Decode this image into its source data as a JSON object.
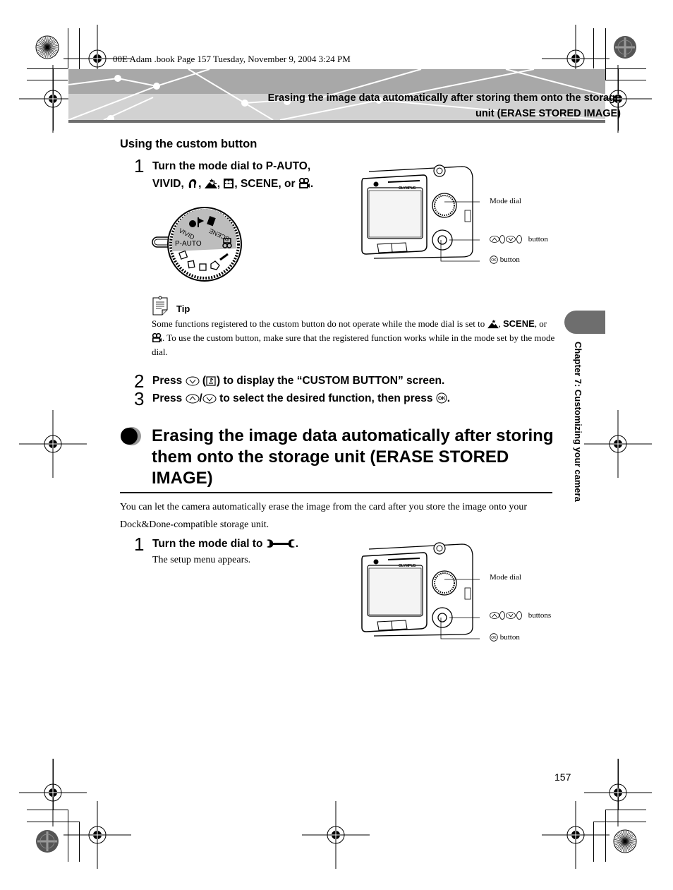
{
  "print_info": "00E Adam .book  Page 157  Tuesday, November 9, 2004  3:24 PM",
  "header": {
    "title_line1": "Erasing the image data automatically after storing them onto the storage",
    "title_line2": "unit (ERASE STORED IMAGE)"
  },
  "custom_button": {
    "subheading": "Using the custom button",
    "step1": {
      "number": "1",
      "line1": "Turn the mode dial to P-AUTO,",
      "line2_prefix": "VIVID,",
      "sep1": ",",
      "sep2": ",",
      "line2_scene": ", SCENE, or",
      "line2_end": "."
    },
    "dial": {
      "labels": [
        "VIVID",
        "P-AUTO",
        "SCENE"
      ]
    },
    "camera1_callouts": {
      "mode_dial": "Mode dial",
      "arrow_buttons": "button",
      "ok_button": "button"
    },
    "tip": {
      "title": "Tip",
      "text_part1": "Some functions registered to the custom button do not operate while the mode dial is set to",
      "text_part2": ",",
      "scene": "SCENE",
      "text_part3": ", or",
      "text_part4": ". To use the custom button, make sure that the registered function works while in the mode set by the mode dial."
    },
    "step2": {
      "number": "2",
      "prefix": "Press",
      "suffix": ") to display the “CUSTOM BUTTON” screen.",
      "open_paren": "("
    },
    "step3": {
      "number": "3",
      "prefix": "Press",
      "slash": "/",
      "middle": "to select the desired function, then press",
      "end": "."
    }
  },
  "erase_section": {
    "title": "Erasing the image data automatically after storing them onto the storage unit (ERASE STORED IMAGE)",
    "intro": "You can let the camera automatically erase the image from the card after you store the image onto your Dock&Done-compatible storage unit.",
    "step1": {
      "number": "1",
      "text": "Turn the mode dial to",
      "end": ".",
      "note": "The setup menu appears."
    },
    "camera2_callouts": {
      "mode_dial": "Mode dial",
      "arrow_buttons": "buttons",
      "ok_button": "button"
    }
  },
  "side_tab": {
    "chapter_label": "Chapter 7: Customizing your camera"
  },
  "footer": {
    "page_number": "157"
  },
  "icons": {
    "portrait": "portrait-icon",
    "night_scene": "night-landscape-icon",
    "self_portrait": "self-portrait-icon",
    "movie": "movie-icon",
    "down_arrow": "down-arrow-button-icon",
    "up_arrow": "up-arrow-button-icon",
    "ok": "ok-button-icon",
    "custom": "custom-button-icon",
    "wrench": "wrench-setup-icon",
    "tip": "tip-note-icon"
  }
}
